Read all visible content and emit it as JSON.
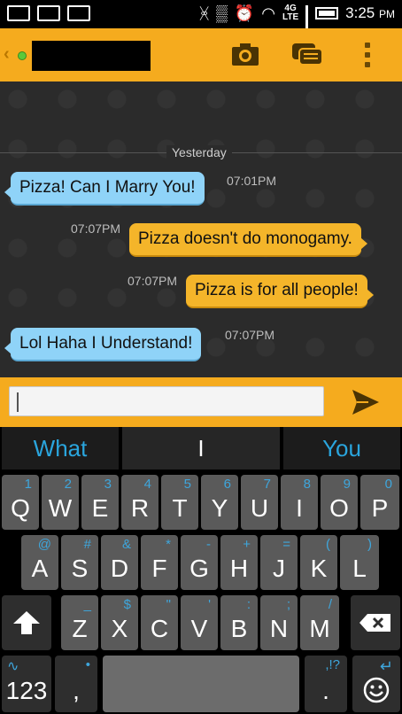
{
  "status_bar": {
    "time": "3:25",
    "ampm": "PM",
    "network": "4G",
    "lte": "LTE"
  },
  "header": {
    "icons": [
      "back-chevron-icon",
      "camera-icon",
      "chat-bubbles-icon",
      "overflow-menu-icon"
    ]
  },
  "chat": {
    "day_separator": "Yesterday",
    "messages": [
      {
        "direction": "in",
        "text": "Pizza! Can I Marry You!",
        "time": "07:01PM"
      },
      {
        "direction": "out",
        "text": "Pizza doesn't do monogamy.",
        "time": "07:07PM"
      },
      {
        "direction": "out",
        "text": "Pizza is for all people!",
        "time": "07:07PM"
      },
      {
        "direction": "in",
        "text": "Lol Haha I Understand!",
        "time": "07:07PM"
      }
    ]
  },
  "composer": {
    "input_value": ""
  },
  "keyboard": {
    "suggestions": [
      "What",
      "I",
      "You"
    ],
    "row1": [
      {
        "label": "Q",
        "hint": "1"
      },
      {
        "label": "W",
        "hint": "2"
      },
      {
        "label": "E",
        "hint": "3"
      },
      {
        "label": "R",
        "hint": "4"
      },
      {
        "label": "T",
        "hint": "5"
      },
      {
        "label": "Y",
        "hint": "6"
      },
      {
        "label": "U",
        "hint": "7"
      },
      {
        "label": "I",
        "hint": "8"
      },
      {
        "label": "O",
        "hint": "9"
      },
      {
        "label": "P",
        "hint": "0"
      }
    ],
    "row2": [
      {
        "label": "A",
        "hint": "@"
      },
      {
        "label": "S",
        "hint": "#"
      },
      {
        "label": "D",
        "hint": "&"
      },
      {
        "label": "F",
        "hint": "*"
      },
      {
        "label": "G",
        "hint": "-"
      },
      {
        "label": "H",
        "hint": "+"
      },
      {
        "label": "J",
        "hint": "="
      },
      {
        "label": "K",
        "hint": "("
      },
      {
        "label": "L",
        "hint": ")"
      }
    ],
    "row3": [
      {
        "label": "Z",
        "hint": "_"
      },
      {
        "label": "X",
        "hint": "$"
      },
      {
        "label": "C",
        "hint": "\""
      },
      {
        "label": "V",
        "hint": "'"
      },
      {
        "label": "B",
        "hint": ":"
      },
      {
        "label": "N",
        "hint": ";"
      },
      {
        "label": "M",
        "hint": "/"
      }
    ],
    "numbers_label": "123",
    "comma_label": ",",
    "period_label": ".",
    "period_hint": ",!?"
  },
  "colors": {
    "accent": "#f5ab1e",
    "incoming_bubble": "#8fd3f8",
    "outgoing_bubble": "#f4b52a",
    "suggestion_text": "#2aa5dd"
  }
}
